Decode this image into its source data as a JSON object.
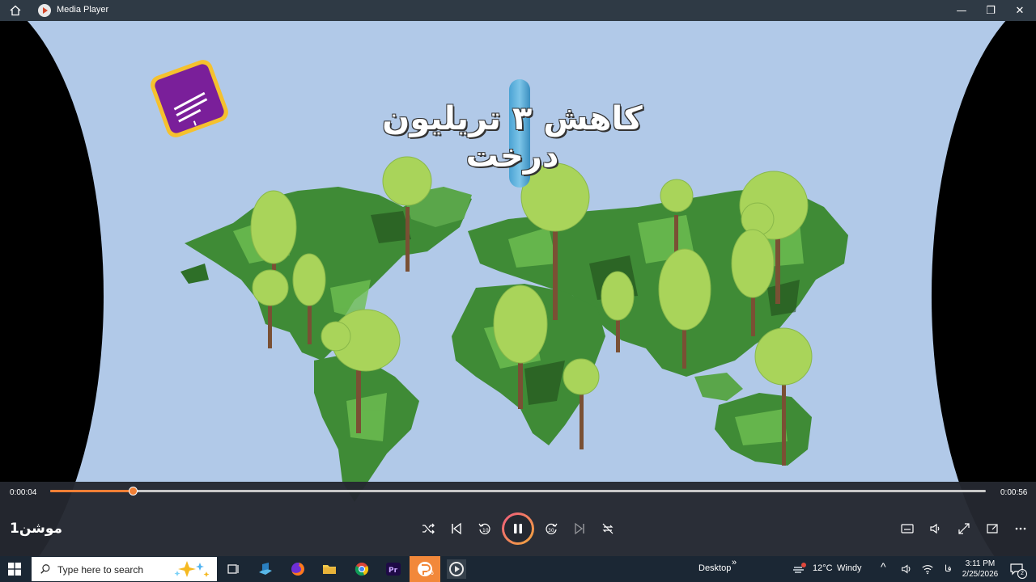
{
  "window": {
    "title": "Media Player",
    "minimize_label": "—",
    "restore_label": "❐",
    "close_label": "✕"
  },
  "video": {
    "overlay_text": "کاهش ۳ تریلیون درخت"
  },
  "playback": {
    "elapsed": "0:00:04",
    "duration": "0:00:56",
    "progress_fraction": 0.088,
    "media_title": "موشن1"
  },
  "colors": {
    "accent": "#f07f35",
    "titlebar": "#2f3a45",
    "controls_bg": "#242830",
    "video_bg": "#b1c9e8",
    "taskbar": "#1b2734"
  },
  "taskbar": {
    "search_placeholder": "Type here to search",
    "desktop_label": "Desktop",
    "desktop_chevron": "»",
    "weather_temp": "12°C",
    "weather_desc": "Windy",
    "language": "فا",
    "time": "3:11 PM",
    "date": "2/25/2026",
    "notification_count": "2",
    "app_badge": "96"
  }
}
